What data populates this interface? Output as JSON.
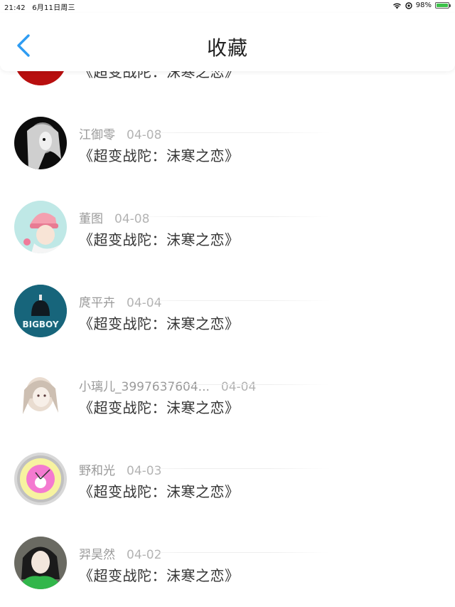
{
  "status_bar": {
    "time": "21:42",
    "date": "6月11日周三",
    "battery": "98%",
    "battery_level": 0.98,
    "icons": [
      "wifi-icon",
      "location-icon",
      "battery-icon"
    ]
  },
  "nav": {
    "title": "收藏",
    "back_icon": "chevron-left-icon",
    "accent_color": "#2e9cf2"
  },
  "favorites": [
    {
      "user": "",
      "date": "",
      "title": "《超变战陀：沫寒之恋》",
      "avatar": "red-round-avatar"
    },
    {
      "user": "江御零",
      "date": "04-08",
      "title": "《超变战陀：沫寒之恋》",
      "avatar": "dark-anime-girl-avatar"
    },
    {
      "user": "董图",
      "date": "04-08",
      "title": "《超变战陀：沫寒之恋》",
      "avatar": "pink-hat-girl-avatar"
    },
    {
      "user": "庹平卉",
      "date": "04-04",
      "title": "《超变战陀：沫寒之恋》",
      "avatar": "bigboy-avatar"
    },
    {
      "user": "小璃儿_3997637604...",
      "date": "04-04",
      "title": "《超变战陀：沫寒之恋》",
      "avatar": "sketch-girl-avatar"
    },
    {
      "user": "野和光",
      "date": "04-03",
      "title": "《超变战陀：沫寒之恋》",
      "avatar": "pink-clock-avatar"
    },
    {
      "user": "羿昊然",
      "date": "04-02",
      "title": "《超变战陀：沫寒之恋》",
      "avatar": "green-jacket-girl-avatar"
    }
  ]
}
